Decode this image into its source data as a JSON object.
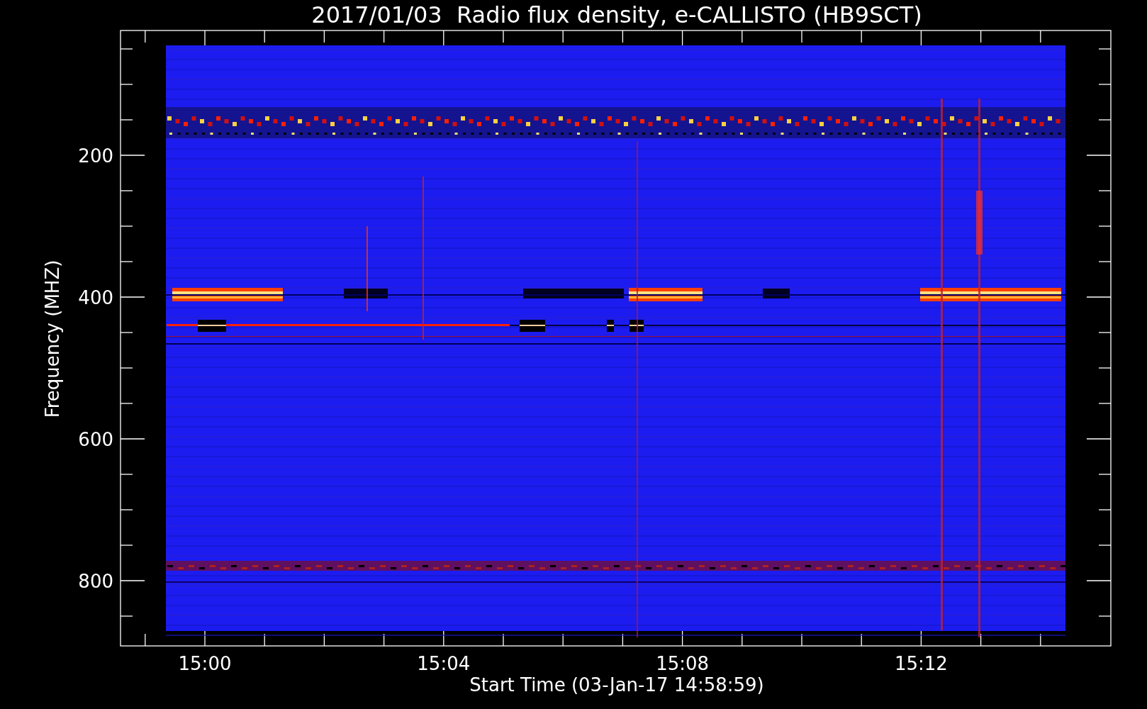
{
  "title": "2017/01/03  Radio flux density, e-CALLISTO (HB9SCT)",
  "y_axis": {
    "label": "Frequency (MHZ)",
    "ticks": [
      "200",
      "400",
      "600",
      "800"
    ]
  },
  "x_axis": {
    "label": "Start Time (03-Jan-17 14:58:59)",
    "ticks": [
      "15:00",
      "15:04",
      "15:08",
      "15:12"
    ]
  }
}
